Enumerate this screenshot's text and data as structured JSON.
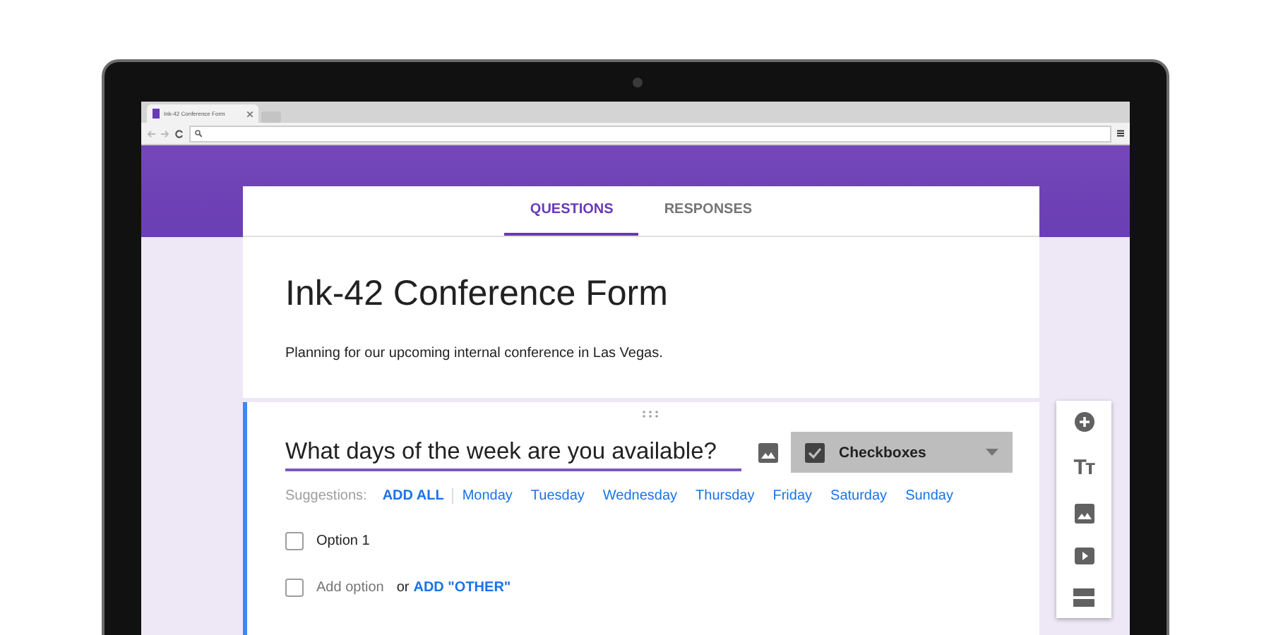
{
  "browser": {
    "tab_title": "Ink-42 Conference Form"
  },
  "form_tabs": [
    {
      "label": "QUESTIONS",
      "selected": true
    },
    {
      "label": "RESPONSES",
      "selected": false
    }
  ],
  "form": {
    "title": "Ink-42 Conference Form",
    "description": "Planning for our upcoming internal conference in Las Vegas."
  },
  "question": {
    "value": "What days of the week are you available?",
    "type": "Checkboxes",
    "suggestions_label": "Suggestions:",
    "add_all": "ADD ALL",
    "suggestions": [
      "Monday",
      "Tuesday",
      "Wednesday",
      "Thursday",
      "Friday",
      "Saturday",
      "Sunday"
    ],
    "options": [
      {
        "label": "Option 1",
        "checked": false
      }
    ],
    "add_option": {
      "label": "Add option",
      "joiner": "or",
      "link": "ADD \"OTHER\"",
      "checked": false
    }
  },
  "side_toolbar": [
    {
      "kind": "add"
    },
    {
      "kind": "title",
      "glyph": "Tт"
    },
    {
      "kind": "image"
    },
    {
      "kind": "video"
    },
    {
      "kind": "section"
    }
  ]
}
